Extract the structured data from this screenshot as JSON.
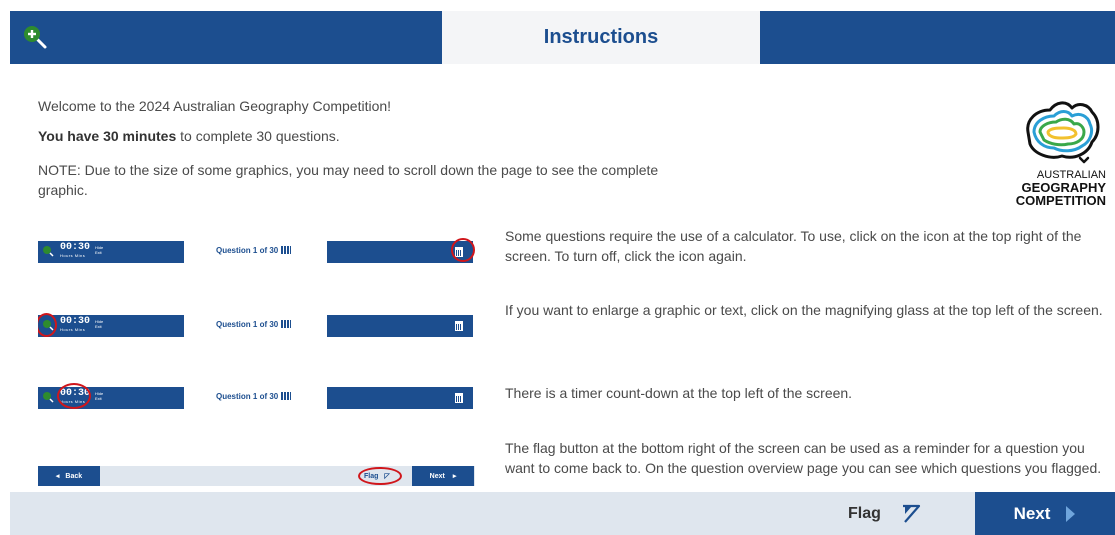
{
  "header": {
    "title": "Instructions",
    "zoom_icon": "magnifier-plus-icon"
  },
  "intro": {
    "welcome": "Welcome to the 2024 Australian Geography Competition!",
    "time_bold": "You have 30 minutes",
    "time_rest": " to complete 30 questions.",
    "note": "NOTE: Due to the size of some graphics, you may need to scroll down the page to see the complete graphic."
  },
  "logo": {
    "line1": "AUSTRALIAN",
    "line2": "GEOGRAPHY",
    "line3": "COMPETITION"
  },
  "mini": {
    "timer": "00:30",
    "timer_units": "Hours Mins",
    "hide": "Hide",
    "hide2": "Exit",
    "question": "Question 1 of 30",
    "back": "Back",
    "flag": "Flag",
    "next": "Next"
  },
  "instructions": [
    {
      "text": "Some questions require the use of a calculator. To use, click on the icon at the top right of the screen. To turn off, click the icon again."
    },
    {
      "text": "If you want to enlarge a graphic or text, click on the magnifying glass at the top left of the screen."
    },
    {
      "text": "There is a timer count-down at the top left of the screen."
    },
    {
      "text": "The flag button at the bottom right of the screen can be used as a reminder for a question you want to come back to. On the question overview page you can see which questions you flagged."
    }
  ],
  "footer": {
    "flag_label": "Flag",
    "next_label": "Next"
  },
  "colors": {
    "primary": "#1c4e8f",
    "highlight_ring": "#d0161b",
    "footer_bg": "#dfe6ee",
    "zoom_green": "#2e8b2e"
  }
}
